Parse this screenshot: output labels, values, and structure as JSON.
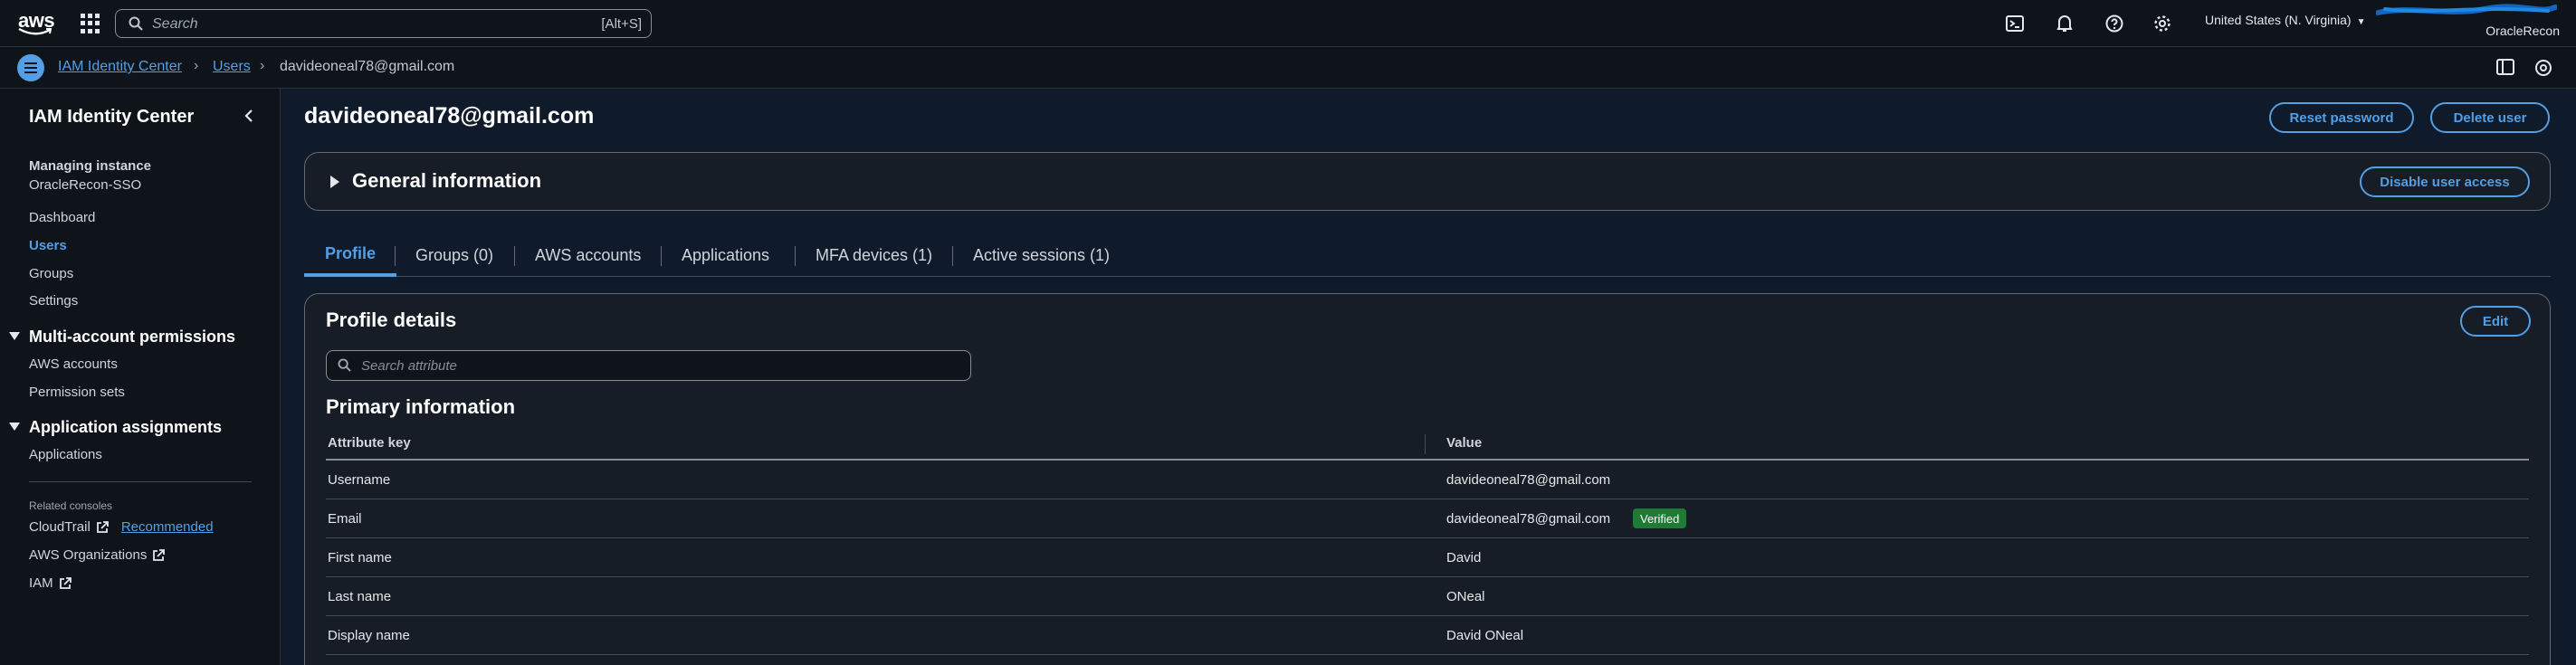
{
  "topnav": {
    "logo_text": "aws",
    "search_placeholder": "Search",
    "search_shortcut": "[Alt+S]",
    "icons": [
      "cloudshell-icon",
      "bell-icon",
      "help-icon",
      "gear-icon"
    ],
    "region": "United States (N. Virginia)",
    "account_name": "OracleRecon"
  },
  "breadcrumb": {
    "items": [
      "IAM Identity Center",
      "Users",
      "davideoneal78@gmail.com"
    ]
  },
  "sidebar": {
    "title": "IAM Identity Center",
    "instance_label": "Managing instance",
    "instance_name": "OracleRecon-SSO",
    "nav": [
      "Dashboard",
      "Users",
      "Groups",
      "Settings"
    ],
    "section_multi": "Multi-account permissions",
    "multi_items": [
      "AWS accounts",
      "Permission sets"
    ],
    "section_app": "Application assignments",
    "app_items": [
      "Applications"
    ],
    "related_label": "Related consoles",
    "related": [
      "CloudTrail",
      "AWS Organizations",
      "IAM"
    ],
    "recommended": "Recommended"
  },
  "main": {
    "title": "davideoneal78@gmail.com",
    "reset_password": "Reset password",
    "delete_user": "Delete user",
    "general_info": "General information",
    "disable_access": "Disable user access",
    "tabs": [
      "Profile",
      "Groups (0)",
      "AWS accounts",
      "Applications",
      "MFA devices (1)",
      "Active sessions (1)"
    ],
    "profile_details": "Profile details",
    "edit": "Edit",
    "search_attr_placeholder": "Search attribute",
    "primary_info": "Primary information",
    "col_key": "Attribute key",
    "col_value": "Value",
    "rows": [
      {
        "key": "Username",
        "value": "davideoneal78@gmail.com"
      },
      {
        "key": "Email",
        "value": "davideoneal78@gmail.com",
        "badge": "Verified"
      },
      {
        "key": "First name",
        "value": "David"
      },
      {
        "key": "Last name",
        "value": "ONeal"
      },
      {
        "key": "Display name",
        "value": "David ONeal"
      }
    ]
  },
  "colors": {
    "accent": "#539fe5",
    "background": "#0f1b2a",
    "verified": "#1f7a34"
  }
}
